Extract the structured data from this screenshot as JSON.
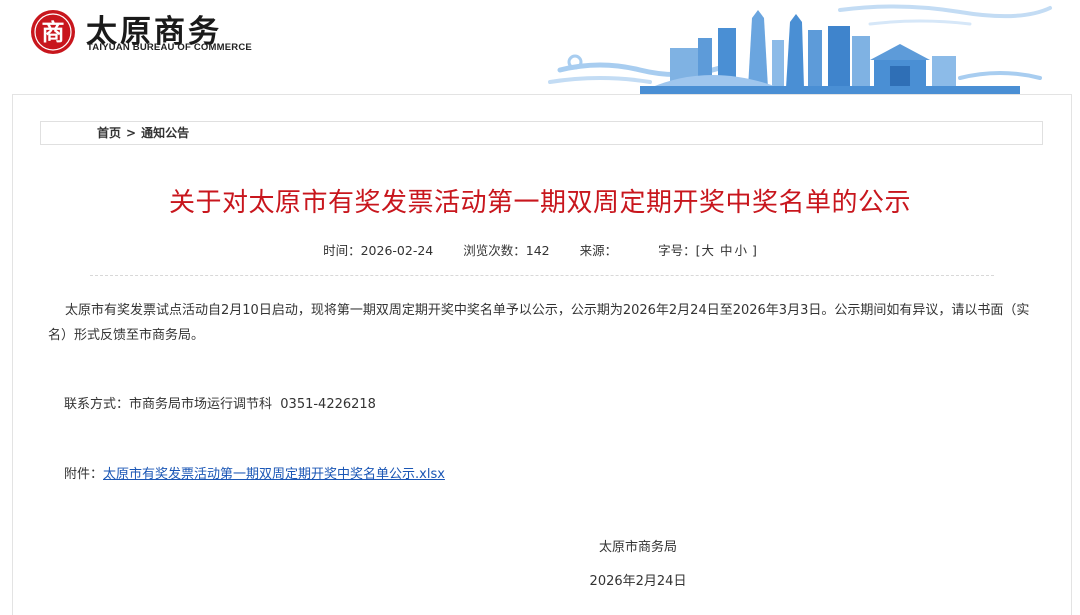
{
  "header": {
    "logo_glyph": "商",
    "site_name_cn": "太原商务",
    "site_name_en": "TAIYUAN BUREAU OF COMMERCE"
  },
  "breadcrumb": {
    "home": "首页",
    "separator": ">",
    "current": "通知公告"
  },
  "article": {
    "title": "关于对太原市有奖发票活动第一期双周定期开奖中奖名单的公示",
    "meta": {
      "time_label": "时间：",
      "time_value": "2026-02-24",
      "views_label": "浏览次数：",
      "views_value": "142",
      "source_label": "来源：",
      "source_value": "",
      "fontsize_label": "字号：",
      "bracket_open": "[",
      "size_large": "大",
      "size_medium": "中",
      "size_small": "小",
      "bracket_close": "]"
    },
    "paragraph1": "太原市有奖发票试点活动自2月10日启动，现将第一期双周定期开奖中奖名单予以公示，公示期为2026年2月24日至2026年3月3日。公示期间如有异议，请以书面（实名）形式反馈至市商务局。",
    "contact_label": "联系方式：",
    "contact_value": "市商务局市场运行调节科  0351-4226218",
    "attachment_label": "附件：",
    "attachment_name": "太原市有奖发票活动第一期双周定期开奖中奖名单公示.xlsx",
    "signature": "太原市商务局",
    "date": "2026年2月24日"
  },
  "colors": {
    "title": "#c8161d",
    "logo": "#c8161d",
    "link": "#1a56b5",
    "skyline_blue": "#4a8fd4"
  }
}
